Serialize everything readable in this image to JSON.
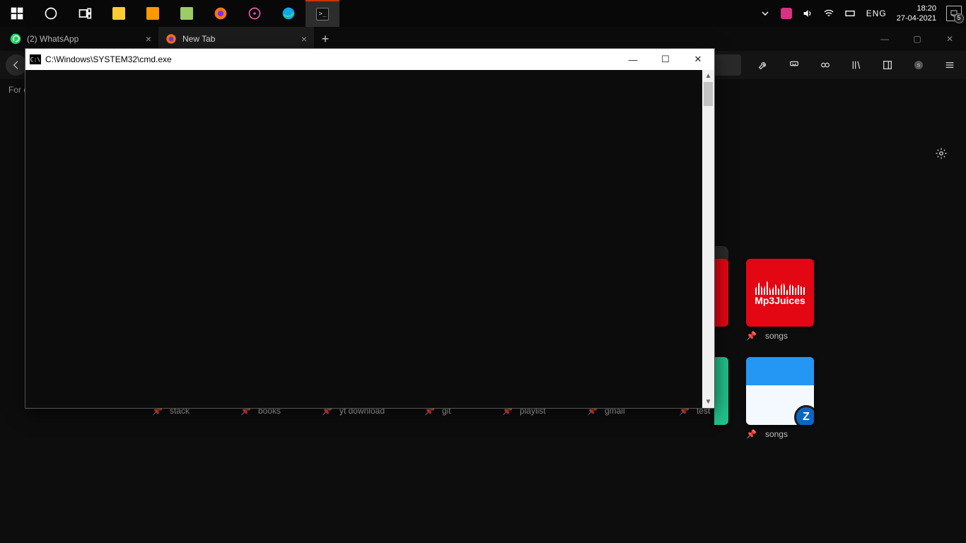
{
  "taskbar": {
    "icons": [
      "start",
      "cortana",
      "taskview",
      "explorer",
      "sublime",
      "notepadpp",
      "firefox",
      "media",
      "edge",
      "cmd"
    ],
    "active": "cmd",
    "tray": {
      "lang": "ENG",
      "time": "18:20",
      "date": "27-04-2021",
      "notifications": "5"
    }
  },
  "firefox": {
    "tabs": [
      {
        "label": "(2) WhatsApp",
        "icon": "whatsapp",
        "active": false
      },
      {
        "label": "New Tab",
        "icon": "firefox",
        "active": true
      }
    ],
    "hint_text": "For q",
    "window_controls": {
      "min": "—",
      "max": "▢",
      "close": "✕"
    },
    "gear_title": "Customize",
    "tiles": {
      "right_top": {
        "label": "songs",
        "brand": "Mp3Juices"
      },
      "right_bottom": {
        "label": "songs"
      }
    },
    "bottom_row_labels": [
      "stack",
      "books",
      "yt download",
      "git",
      "playlist",
      "gmail",
      "test"
    ]
  },
  "cmd": {
    "title": "C:\\Windows\\SYSTEM32\\cmd.exe",
    "icon_text": "C:\\",
    "controls": {
      "min": "—",
      "max": "☐",
      "close": "✕"
    }
  }
}
